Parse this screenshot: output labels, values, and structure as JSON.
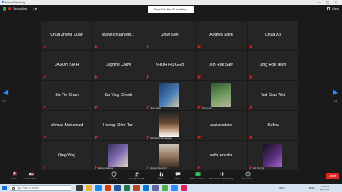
{
  "window": {
    "title": "Zoom Meeting"
  },
  "topbar": {
    "recording_label": "Recording",
    "recording_pause": "|| ■",
    "notice": "Daryl Goh Wei Zhi is talking.",
    "view_label": "View"
  },
  "pages": {
    "left": "1/2",
    "right": "1/2"
  },
  "participants": [
    {
      "name": "Chua Zheng Xuan",
      "label": ""
    },
    {
      "name": "joslyn chuah em...",
      "label": ""
    },
    {
      "name": "Zhiyi Soh",
      "label": ""
    },
    {
      "name": "Andrea Siten",
      "label": ""
    },
    {
      "name": "Chua Xp",
      "label": ""
    },
    {
      "name": "JASON SIAH",
      "label": ""
    },
    {
      "name": "Daphne Chew",
      "label": ""
    },
    {
      "name": "KHOR HUIGEN",
      "label": ""
    },
    {
      "name": "Xin Rue Saw",
      "label": ""
    },
    {
      "name": "Jing Rou Teoh",
      "label": ""
    },
    {
      "name": "Sin Yie Chan",
      "label": ""
    },
    {
      "name": "Kai Ying Cheok",
      "label": ""
    },
    {
      "name": "",
      "label": "Joey Yang"
    },
    {
      "name": "",
      "label": "Bryan Ho"
    },
    {
      "name": "Yak Siao Wei",
      "label": ""
    },
    {
      "name": "Ahmad Mohamad",
      "label": ""
    },
    {
      "name": "Hoong Chim Tan",
      "label": ""
    },
    {
      "name": "",
      "label": "Sucharita Srinangam"
    },
    {
      "name": "aiai zeadora",
      "label": ""
    },
    {
      "name": "Sofea",
      "label": ""
    },
    {
      "name": "Qing Ying",
      "label": ""
    },
    {
      "name": "",
      "label": "akira natasha"
    },
    {
      "name": "",
      "label": "Goyah Rentazil"
    },
    {
      "name": "sofia Antolini",
      "label": ""
    },
    {
      "name": "",
      "label": "loh hui ling"
    }
  ],
  "toolbar": {
    "mute": "Mute",
    "video": "Start Video",
    "security": "Security",
    "participants": "Participants",
    "participants_count": "55",
    "polls": "Polls",
    "chat": "Chat",
    "share": "Share Screen",
    "record": "Pause/Stop Recording",
    "reactions": "Reactions",
    "end": "Leave"
  },
  "taskbar": {
    "search_placeholder": "Type here to search",
    "weather": "33°C",
    "lang": "ENG",
    "time": "4:53 PM",
    "date": "6/1/2021"
  },
  "colors": {
    "accent": "#2d8cff",
    "muted_red": "#e02828",
    "share_green": "#24b04a"
  }
}
